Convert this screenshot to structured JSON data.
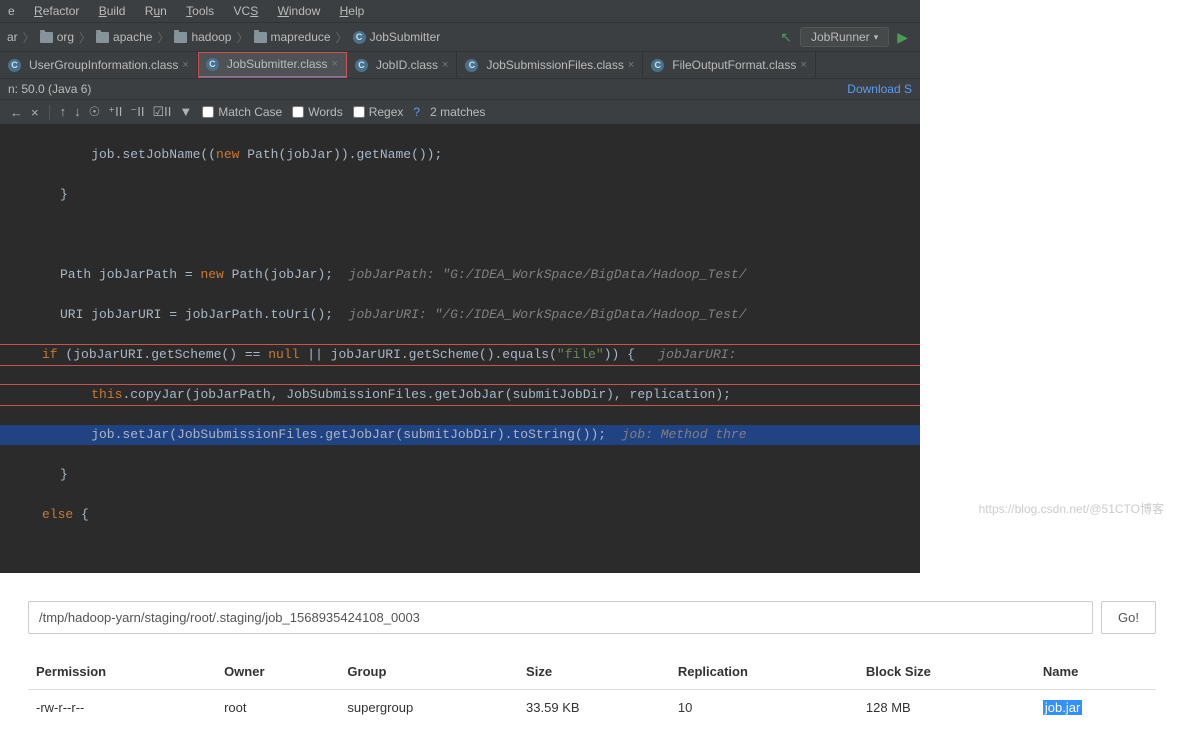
{
  "menu": [
    "e",
    "Refactor",
    "Build",
    "Run",
    "Tools",
    "VCS",
    "Window",
    "Help"
  ],
  "breadcrumb": {
    "items": [
      "ar",
      "org",
      "apache",
      "hadoop",
      "mapreduce",
      "JobSubmitter"
    ],
    "run_config": "JobRunner"
  },
  "tabs": [
    {
      "label": "UserGroupInformation.class",
      "active": false
    },
    {
      "label": "JobSubmitter.class",
      "active": true
    },
    {
      "label": "JobID.class",
      "active": false
    },
    {
      "label": "JobSubmissionFiles.class",
      "active": false
    },
    {
      "label": "FileOutputFormat.class",
      "active": false
    }
  ],
  "status": {
    "left": "n: 50.0 (Java 6)",
    "right": "Download S"
  },
  "findbar": {
    "match_case": "Match Case",
    "words": "Words",
    "regex": "Regex",
    "help": "?",
    "matches": "2 matches"
  },
  "code": {
    "l1a": "    job.setJobName((",
    "l1b": "new",
    "l1c": " Path(jobJar)).getName());",
    "l2": "}",
    "l4a": "Path jobJarPath = ",
    "l4b": "new",
    "l4c": " Path(jobJar);  ",
    "l4d": "jobJarPath: \"G:/IDEA_WorkSpace/BigData/Hadoop_Test/",
    "l5a": "URI jobJarURI = jobJarPath.toUri();  ",
    "l5b": "jobJarURI: \"/G:/IDEA_WorkSpace/BigData/Hadoop_Test/",
    "l6a": "if",
    "l6b": " (jobJarURI.getScheme() == ",
    "l6c": "null",
    "l6d": " || jobJarURI.getScheme().equals(",
    "l6e": "\"file\"",
    "l6f": ")) {   ",
    "l6g": "jobJarURI:",
    "l7a": "    ",
    "l7b": "this",
    "l7c": ".copyJar(jobJarPath, JobSubmissionFiles.getJobJar(submitJobDir), replication);",
    "l8a": "    job.setJar(JobSubmissionFiles.getJobJar(submitJobDir).toString());  ",
    "l8b": "job: Method thre",
    "l9": "}",
    "l10a": "else",
    "l10b": " {"
  },
  "browser": {
    "path": "/tmp/hadoop-yarn/staging/root/.staging/job_1568935424108_0003",
    "go": "Go!",
    "headers": [
      "Permission",
      "Owner",
      "Group",
      "Size",
      "Replication",
      "Block Size",
      "Name"
    ],
    "row": {
      "permission": "-rw-r--r--",
      "owner": "root",
      "group": "supergroup",
      "size": "33.59 KB",
      "replication": "10",
      "block_size": "128 MB",
      "name": "job.jar"
    }
  },
  "watermark": "https://blog.csdn.net/@51CTO博客"
}
